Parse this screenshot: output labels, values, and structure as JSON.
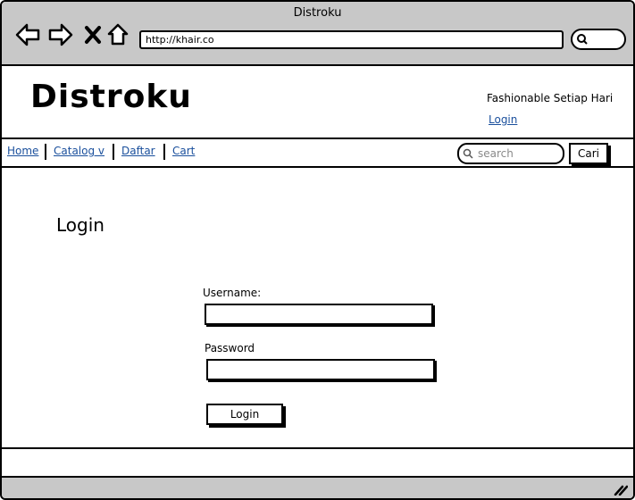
{
  "window": {
    "title": "Distroku"
  },
  "browser": {
    "url": "http://khair.co"
  },
  "icons": [
    "back-arrow-icon",
    "forward-arrow-icon",
    "close-x-icon",
    "home-icon",
    "search-icon",
    "resize-grip-icon"
  ],
  "header": {
    "brand": "Distroku",
    "tagline": "Fashionable Setiap Hari",
    "login_link": "Login"
  },
  "nav": {
    "items": [
      "Home",
      "Catalog v",
      "Daftar",
      "Cart"
    ],
    "search_placeholder": "search",
    "search_button": "Cari"
  },
  "login_form": {
    "title": "Login",
    "username_label": "Username:",
    "username_value": "",
    "password_label": "Password",
    "password_value": "",
    "submit_label": "Login"
  },
  "colors": {
    "chrome": "#c8c8c8",
    "link": "#1a4f9c",
    "border": "#000000"
  }
}
